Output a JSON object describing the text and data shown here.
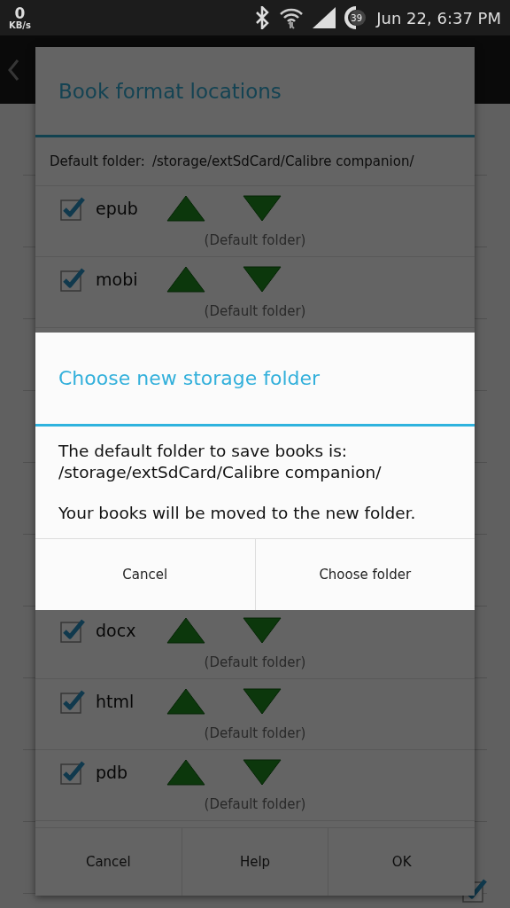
{
  "status_bar": {
    "speed": "0",
    "speed_unit": "KB/s",
    "battery": "39",
    "time": "Jun 22, 6:37 PM"
  },
  "background": {
    "last_checked": true
  },
  "formats_dialog": {
    "title": "Book format locations",
    "default_folder_label": "Default folder:",
    "default_folder": "/storage/extSdCard/Calibre companion/",
    "formats_top": [
      {
        "name": "epub",
        "checked": true,
        "location": "(Default folder)"
      },
      {
        "name": "mobi",
        "checked": true,
        "location": "(Default folder)"
      }
    ],
    "formats_bottom": [
      {
        "name": "docx",
        "checked": true,
        "location": "(Default folder)"
      },
      {
        "name": "html",
        "checked": true,
        "location": "(Default folder)"
      },
      {
        "name": "pdb",
        "checked": true,
        "location": "(Default folder)"
      }
    ],
    "buttons": [
      "Cancel",
      "Help",
      "OK"
    ]
  },
  "storage_dialog": {
    "title": "Choose new storage folder",
    "message": [
      "The default folder to save books is:\n/storage/extSdCard/Calibre companion/",
      "Your books will be moved to the new folder."
    ],
    "buttons": [
      "Cancel",
      "Choose folder"
    ]
  }
}
